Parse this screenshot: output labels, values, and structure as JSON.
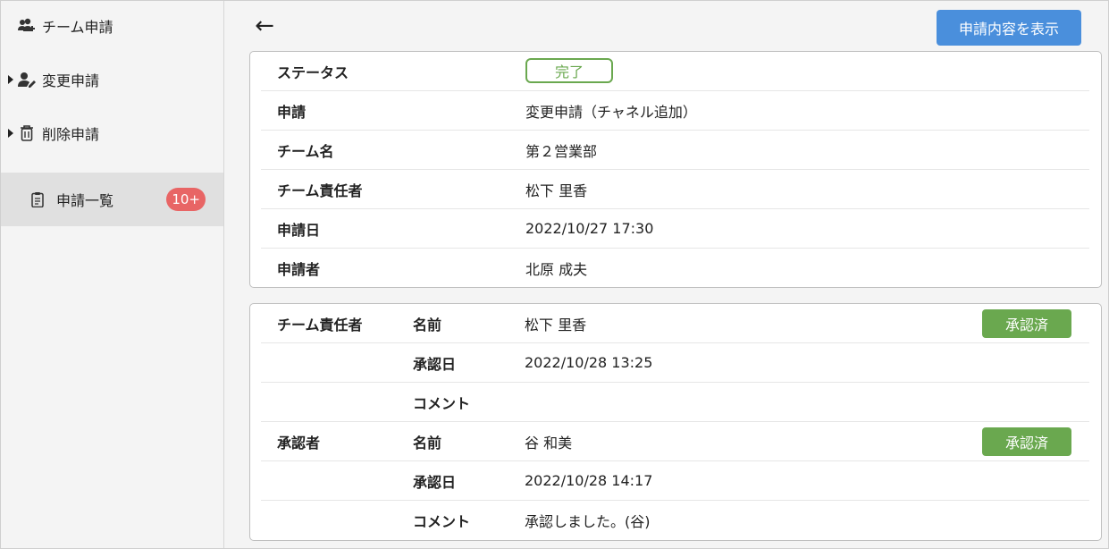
{
  "sidebar": {
    "items": [
      {
        "label": "チーム申請",
        "icon": "team-icon"
      },
      {
        "label": "変更申請",
        "icon": "user-edit-icon"
      },
      {
        "label": "削除申請",
        "icon": "trash-icon"
      },
      {
        "label": "申請一覧",
        "icon": "clipboard-icon",
        "badge": "10+"
      }
    ]
  },
  "header": {
    "back_symbol": "←",
    "show_button": "申請内容を表示"
  },
  "details": {
    "status_label": "ステータス",
    "status_value": "完了",
    "application_label": "申請",
    "application_value": "変更申請（チャネル追加）",
    "team_name_label": "チーム名",
    "team_name_value": "第２営業部",
    "owner_label": "チーム責任者",
    "owner_value": "松下 里香",
    "date_label": "申請日",
    "date_value": "2022/10/27 17:30",
    "applicant_label": "申請者",
    "applicant_value": "北原 成夫"
  },
  "approvals": [
    {
      "role": "チーム責任者",
      "name_label": "名前",
      "name": "松下 里香",
      "status": "承認済",
      "date_label": "承認日",
      "date": "2022/10/28 13:25",
      "comment_label": "コメント",
      "comment": ""
    },
    {
      "role": "承認者",
      "name_label": "名前",
      "name": "谷 和美",
      "status": "承認済",
      "date_label": "承認日",
      "date": "2022/10/28 14:17",
      "comment_label": "コメント",
      "comment": "承認しました。(谷)"
    }
  ],
  "colors": {
    "primary": "#4a8fdc",
    "success": "#6aa84f",
    "badge": "#e86565"
  }
}
